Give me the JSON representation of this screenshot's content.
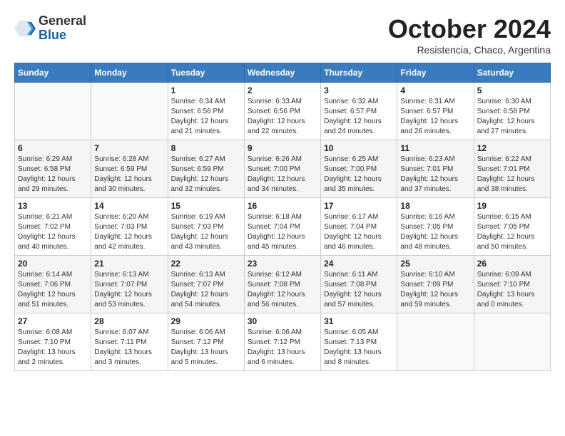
{
  "header": {
    "logo_general": "General",
    "logo_blue": "Blue",
    "month_title": "October 2024",
    "subtitle": "Resistencia, Chaco, Argentina"
  },
  "weekdays": [
    "Sunday",
    "Monday",
    "Tuesday",
    "Wednesday",
    "Thursday",
    "Friday",
    "Saturday"
  ],
  "weeks": [
    [
      {
        "day": "",
        "info": ""
      },
      {
        "day": "",
        "info": ""
      },
      {
        "day": "1",
        "info": "Sunrise: 6:34 AM\nSunset: 6:56 PM\nDaylight: 12 hours and 21 minutes."
      },
      {
        "day": "2",
        "info": "Sunrise: 6:33 AM\nSunset: 6:56 PM\nDaylight: 12 hours and 22 minutes."
      },
      {
        "day": "3",
        "info": "Sunrise: 6:32 AM\nSunset: 6:57 PM\nDaylight: 12 hours and 24 minutes."
      },
      {
        "day": "4",
        "info": "Sunrise: 6:31 AM\nSunset: 6:57 PM\nDaylight: 12 hours and 26 minutes."
      },
      {
        "day": "5",
        "info": "Sunrise: 6:30 AM\nSunset: 6:58 PM\nDaylight: 12 hours and 27 minutes."
      }
    ],
    [
      {
        "day": "6",
        "info": "Sunrise: 6:29 AM\nSunset: 6:58 PM\nDaylight: 12 hours and 29 minutes."
      },
      {
        "day": "7",
        "info": "Sunrise: 6:28 AM\nSunset: 6:59 PM\nDaylight: 12 hours and 30 minutes."
      },
      {
        "day": "8",
        "info": "Sunrise: 6:27 AM\nSunset: 6:59 PM\nDaylight: 12 hours and 32 minutes."
      },
      {
        "day": "9",
        "info": "Sunrise: 6:26 AM\nSunset: 7:00 PM\nDaylight: 12 hours and 34 minutes."
      },
      {
        "day": "10",
        "info": "Sunrise: 6:25 AM\nSunset: 7:00 PM\nDaylight: 12 hours and 35 minutes."
      },
      {
        "day": "11",
        "info": "Sunrise: 6:23 AM\nSunset: 7:01 PM\nDaylight: 12 hours and 37 minutes."
      },
      {
        "day": "12",
        "info": "Sunrise: 6:22 AM\nSunset: 7:01 PM\nDaylight: 12 hours and 38 minutes."
      }
    ],
    [
      {
        "day": "13",
        "info": "Sunrise: 6:21 AM\nSunset: 7:02 PM\nDaylight: 12 hours and 40 minutes."
      },
      {
        "day": "14",
        "info": "Sunrise: 6:20 AM\nSunset: 7:03 PM\nDaylight: 12 hours and 42 minutes."
      },
      {
        "day": "15",
        "info": "Sunrise: 6:19 AM\nSunset: 7:03 PM\nDaylight: 12 hours and 43 minutes."
      },
      {
        "day": "16",
        "info": "Sunrise: 6:18 AM\nSunset: 7:04 PM\nDaylight: 12 hours and 45 minutes."
      },
      {
        "day": "17",
        "info": "Sunrise: 6:17 AM\nSunset: 7:04 PM\nDaylight: 12 hours and 46 minutes."
      },
      {
        "day": "18",
        "info": "Sunrise: 6:16 AM\nSunset: 7:05 PM\nDaylight: 12 hours and 48 minutes."
      },
      {
        "day": "19",
        "info": "Sunrise: 6:15 AM\nSunset: 7:05 PM\nDaylight: 12 hours and 50 minutes."
      }
    ],
    [
      {
        "day": "20",
        "info": "Sunrise: 6:14 AM\nSunset: 7:06 PM\nDaylight: 12 hours and 51 minutes."
      },
      {
        "day": "21",
        "info": "Sunrise: 6:13 AM\nSunset: 7:07 PM\nDaylight: 12 hours and 53 minutes."
      },
      {
        "day": "22",
        "info": "Sunrise: 6:13 AM\nSunset: 7:07 PM\nDaylight: 12 hours and 54 minutes."
      },
      {
        "day": "23",
        "info": "Sunrise: 6:12 AM\nSunset: 7:08 PM\nDaylight: 12 hours and 56 minutes."
      },
      {
        "day": "24",
        "info": "Sunrise: 6:11 AM\nSunset: 7:08 PM\nDaylight: 12 hours and 57 minutes."
      },
      {
        "day": "25",
        "info": "Sunrise: 6:10 AM\nSunset: 7:09 PM\nDaylight: 12 hours and 59 minutes."
      },
      {
        "day": "26",
        "info": "Sunrise: 6:09 AM\nSunset: 7:10 PM\nDaylight: 13 hours and 0 minutes."
      }
    ],
    [
      {
        "day": "27",
        "info": "Sunrise: 6:08 AM\nSunset: 7:10 PM\nDaylight: 13 hours and 2 minutes."
      },
      {
        "day": "28",
        "info": "Sunrise: 6:07 AM\nSunset: 7:11 PM\nDaylight: 13 hours and 3 minutes."
      },
      {
        "day": "29",
        "info": "Sunrise: 6:06 AM\nSunset: 7:12 PM\nDaylight: 13 hours and 5 minutes."
      },
      {
        "day": "30",
        "info": "Sunrise: 6:06 AM\nSunset: 7:12 PM\nDaylight: 13 hours and 6 minutes."
      },
      {
        "day": "31",
        "info": "Sunrise: 6:05 AM\nSunset: 7:13 PM\nDaylight: 13 hours and 8 minutes."
      },
      {
        "day": "",
        "info": ""
      },
      {
        "day": "",
        "info": ""
      }
    ]
  ]
}
